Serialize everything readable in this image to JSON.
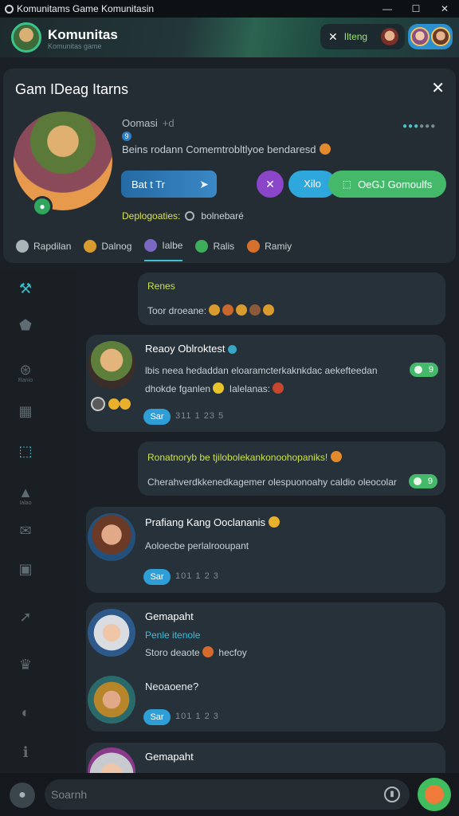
{
  "window": {
    "title": "Komunitams Game Komunitasin",
    "controls": [
      "—",
      "☐",
      "✕"
    ]
  },
  "header": {
    "title": "Komunitas",
    "subtitle": "Komunitas game",
    "pill_label": "Ilteng"
  },
  "community": {
    "title": "Gam IDeag Itarns",
    "close": "✕",
    "label1": "Oomasi",
    "label1_dim": "+d",
    "badge": "9",
    "description": "Beins rodann Comemtrobltlyoe bendaresd",
    "primary_button": "Bat t Tr",
    "purple_button": "✕",
    "blue_button": "Xilo",
    "green_button": "OeGJ Gomoulfs",
    "meta_label": "Deplogoaties:",
    "meta_value": "bolnebaré"
  },
  "tabs": [
    {
      "label": "Rapdilan",
      "color": "#aab5ba"
    },
    {
      "label": "Dalnog",
      "color": "#d99b2e"
    },
    {
      "label": "Ialbe",
      "color": "#7a68c2"
    },
    {
      "label": "Ralis",
      "color": "#3fae5b"
    },
    {
      "label": "Ramiy",
      "color": "#d6712c"
    }
  ],
  "sidebar": [
    {
      "icon": "hammer-icon",
      "glyph": "⚒",
      "label": ""
    },
    {
      "icon": "shield-icon",
      "glyph": "⬟",
      "label": ""
    },
    {
      "icon": "gamepad-icon",
      "glyph": "⊛",
      "label": "Ranio"
    },
    {
      "icon": "calendar-icon",
      "glyph": "▦",
      "label": ""
    },
    {
      "icon": "puzzle-icon",
      "glyph": "⬚",
      "label": ""
    },
    {
      "icon": "alert-icon",
      "glyph": "▲",
      "label": "Ialao"
    },
    {
      "icon": "mail-icon",
      "glyph": "✉",
      "label": ""
    },
    {
      "icon": "chest-icon",
      "glyph": "▣",
      "label": ""
    },
    {
      "icon": "arrow-icon",
      "glyph": "➚",
      "label": ""
    },
    {
      "icon": "crown-icon",
      "glyph": "♛",
      "label": ""
    },
    {
      "icon": "clock-icon",
      "glyph": "◐",
      "label": ""
    },
    {
      "icon": "info-icon",
      "glyph": "ℹ",
      "label": ""
    }
  ],
  "posts": [
    {
      "name": "Renes",
      "text": "Toor droeane:"
    },
    {
      "name": "Reaoy Oblroktest",
      "line1": "lbis neea hedaddan eloaramcterkaknkdac aekefteedan",
      "line2": "dhokde fganlen",
      "line2b": "Ialelanas:",
      "count": "9",
      "button": "Sar",
      "stamp": "311 1 23 5"
    },
    {
      "title": "Ronatnoryb be tjilobolekankonoohopaniks!",
      "text": "Cherahverdkkenedkagemer olespuonoahy caldio oleocolar",
      "count": "9"
    },
    {
      "name": "Prafiang Kang Ooclananis",
      "text": "Aoloecbe perlalrooupant",
      "button": "Sar",
      "stamp": "101 1 2 3"
    },
    {
      "name": "Gemapaht",
      "sub": "Penle itenole",
      "text": "Storo deaote",
      "text_after": "hecfoy",
      "reply": "Neoaoene?",
      "button": "Sar",
      "stamp": "101 1 2 3"
    },
    {
      "name": "Gemapaht"
    }
  ],
  "search": {
    "placeholder": "Soarnh"
  }
}
